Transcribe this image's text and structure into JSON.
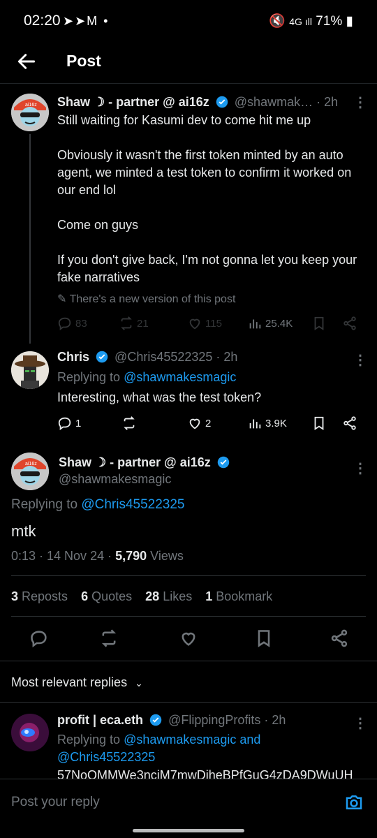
{
  "status_bar": {
    "time": "02:20",
    "left_icons": "➤➤M •",
    "battery": "71%"
  },
  "header": {
    "title": "Post"
  },
  "post1": {
    "display_name": "Shaw ☽ - partner @ ai16z",
    "handle": "@shawmak…",
    "time": "· 2h",
    "body": "Still waiting for Kasumi dev to come hit me up\n\nObviously it wasn't the first token minted by an auto agent, we minted a test token to confirm it worked on our end lol\n\nCome on guys\n\nIf you don't give back, I'm not gonna let you keep your fake narratives",
    "edited_notice": "There's a new version of this post",
    "replies": "83",
    "reposts": "21",
    "likes": "115",
    "views": "25.4K"
  },
  "post2": {
    "display_name": "Chris",
    "handle": "@Chris45522325 · 2h",
    "replying_prefix": "Replying to ",
    "replying_to": "@shawmakesmagic",
    "body": "Interesting, what was the test token?",
    "replies": "1",
    "reposts": "",
    "likes": "2",
    "views": "3.9K"
  },
  "main_post": {
    "display_name": "Shaw ☽ - partner @ ai16z",
    "handle": "@shawmakesmagic",
    "replying_prefix": "Replying to ",
    "replying_to": "@Chris45522325",
    "body": "mtk",
    "time_date": "0:13 · 14 Nov 24 · ",
    "views_count": "5,790",
    "views_label": " Views",
    "reposts_count": "3",
    "reposts_label": " Reposts",
    "quotes_count": "6",
    "quotes_label": " Quotes",
    "likes_count": "28",
    "likes_label": " Likes",
    "bookmarks_count": "1",
    "bookmarks_label": " Bookmark"
  },
  "replies_section": {
    "sort_label": "Most relevant replies"
  },
  "reply1": {
    "display_name": "profit | eca.eth",
    "handle": "@FlippingProfits · 2h",
    "replying_prefix": "Replying to ",
    "replying_to_1": "@shawmakesmagic and",
    "replying_to_2": "@Chris45522325",
    "body_partial": "57NoQMMWe3nciM7mwDiheBPfGuG4zDA9DWuUH"
  },
  "composer": {
    "placeholder": "Post your reply"
  },
  "colors": {
    "background": "#000000",
    "link": "#1d9bf0",
    "muted": "#71767b",
    "text": "#e7e9ea"
  }
}
